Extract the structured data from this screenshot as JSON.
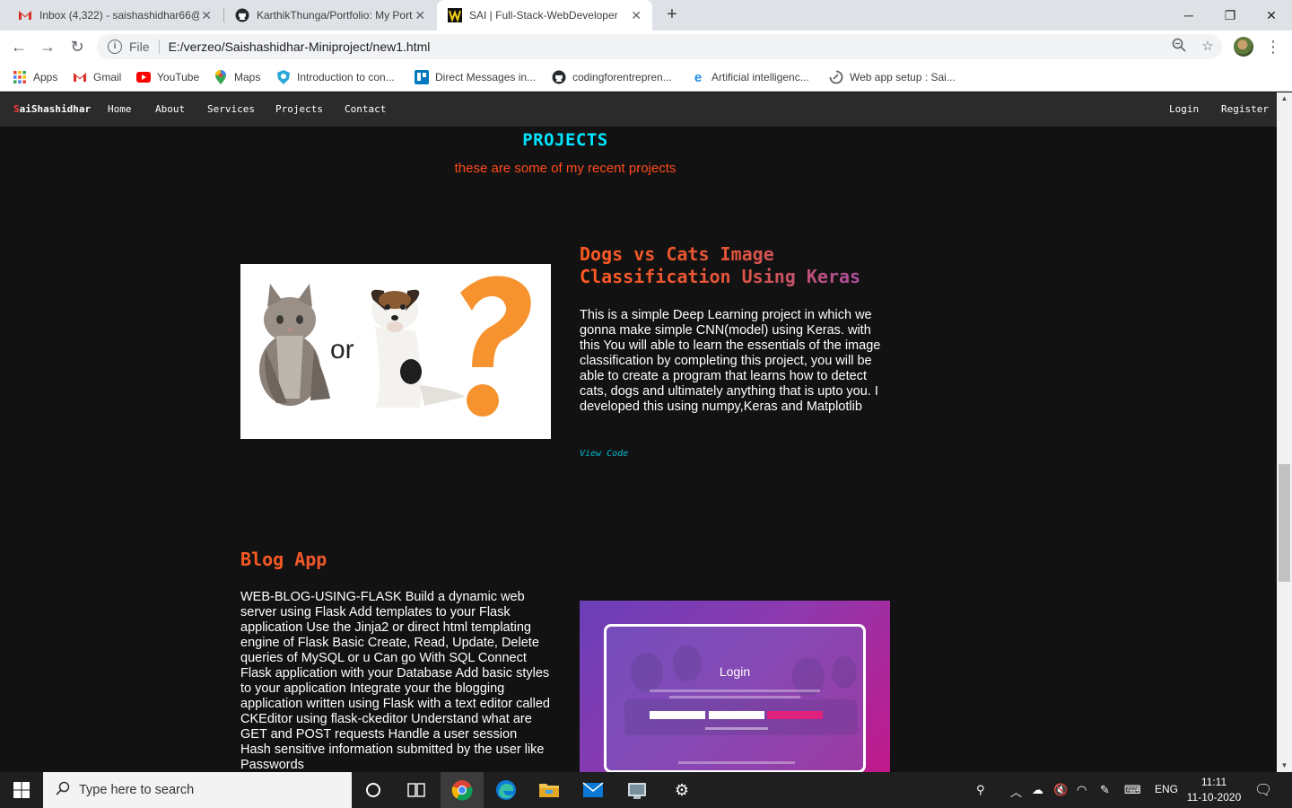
{
  "browser": {
    "tabs": [
      {
        "title": "Inbox (4,322) - saishashidhar66@",
        "icon": "gmail-icon"
      },
      {
        "title": "KarthikThunga/Portfolio: My Port",
        "icon": "github-icon"
      },
      {
        "title": "SAI | Full-Stack-WebDeveloper",
        "icon": "site-icon",
        "active": true
      }
    ],
    "address": {
      "scheme_label": "File",
      "url": "E:/verzeo/Saishashidhar-Miniproject/new1.html"
    },
    "bookmarks": [
      {
        "label": "Apps",
        "icon": "apps-grid-icon"
      },
      {
        "label": "Gmail",
        "icon": "gmail-icon"
      },
      {
        "label": "YouTube",
        "icon": "youtube-icon"
      },
      {
        "label": "Maps",
        "icon": "maps-icon"
      },
      {
        "label": "Introduction to con...",
        "icon": "shield-icon"
      },
      {
        "label": "Direct Messages in...",
        "icon": "trello-icon"
      },
      {
        "label": "codingforentrepren...",
        "icon": "github-icon"
      },
      {
        "label": "Artificial intelligenc...",
        "icon": "edge-icon"
      },
      {
        "label": "Web app setup : Sai...",
        "icon": "loading-icon"
      }
    ]
  },
  "site": {
    "brand_first": "S",
    "brand_rest": "aiShashidhar",
    "nav": {
      "home": "Home",
      "about": "About",
      "services": "Services",
      "projects": "Projects",
      "contact": "Contact",
      "login": "Login",
      "register": "Register"
    },
    "section": {
      "title": "PROJECTS",
      "subtitle": "these are some of my recent projects"
    },
    "projects": [
      {
        "title": "Dogs vs Cats Image Classification Using Keras",
        "description": "This is a simple Deep Learning project in which we gonna make simple CNN(model) using Keras. with this You will able to learn the essentials of the image classification by completing this project, you will be able to create a program that learns how to detect cats, dogs and ultimately anything that is upto you. I developed this using numpy,Keras and Matplotlib",
        "link": "View Code",
        "image_text": "or"
      },
      {
        "title": "Blog App",
        "description": "WEB-BLOG-USING-FLASK Build a dynamic web server using Flask Add templates to your Flask application Use the Jinja2 or direct html templating engine of Flask Basic Create, Read, Update, Delete queries of MySQL or u Can go With SQL Connect Flask application with your Database Add basic styles to your application Integrate your the blogging application written using Flask with a text editor called CKEditor using flask-ckeditor Understand what are GET and POST requests Handle a user session Hash sensitive information submitted by the user like Passwords",
        "image_text": "Login"
      }
    ]
  },
  "taskbar": {
    "search_placeholder": "Type here to search",
    "language": "ENG",
    "time": "11:11",
    "date": "11-10-2020"
  },
  "colors": {
    "page_bg": "#121212",
    "navbar_bg": "#2b2b2b",
    "section_title": "#00e5ff",
    "section_subtitle": "#ff4a1a",
    "project_title_start": "#ff5a1f",
    "project_title_end": "#a04dbb",
    "link": "#00bcd4"
  }
}
